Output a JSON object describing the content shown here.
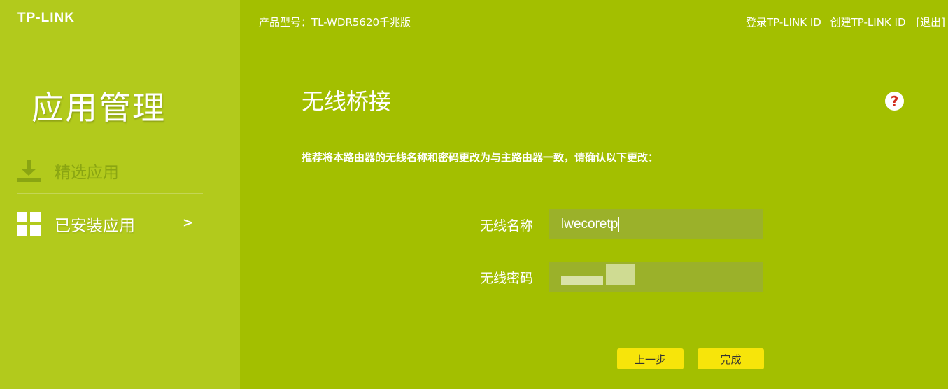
{
  "brand": {
    "logo": "TP-LINK"
  },
  "header": {
    "model": "产品型号：TL-WDR5620千兆版",
    "login_link": "登录TP-LINK ID",
    "create_link": "创建TP-LINK ID",
    "logout": "[退出]"
  },
  "sidebar": {
    "title": "应用管理",
    "items": [
      {
        "label": "精选应用",
        "icon": "download-icon"
      },
      {
        "label": "已安装应用",
        "icon": "grid-icon",
        "chevron": ">"
      }
    ]
  },
  "main": {
    "title": "无线桥接",
    "help": "?",
    "instruction": "推荐将本路由器的无线名称和密码更改为与主路由器一致，请确认以下更改：",
    "ssid_label": "无线名称",
    "ssid_value": "lwecoretp",
    "password_label": "无线密码",
    "prev_button": "上一步",
    "finish_button": "完成"
  },
  "colors": {
    "background": "#a3bf00",
    "sidebar": "#b2ca1c",
    "button": "#f7e50a",
    "help_mark": "#d22d1e"
  }
}
